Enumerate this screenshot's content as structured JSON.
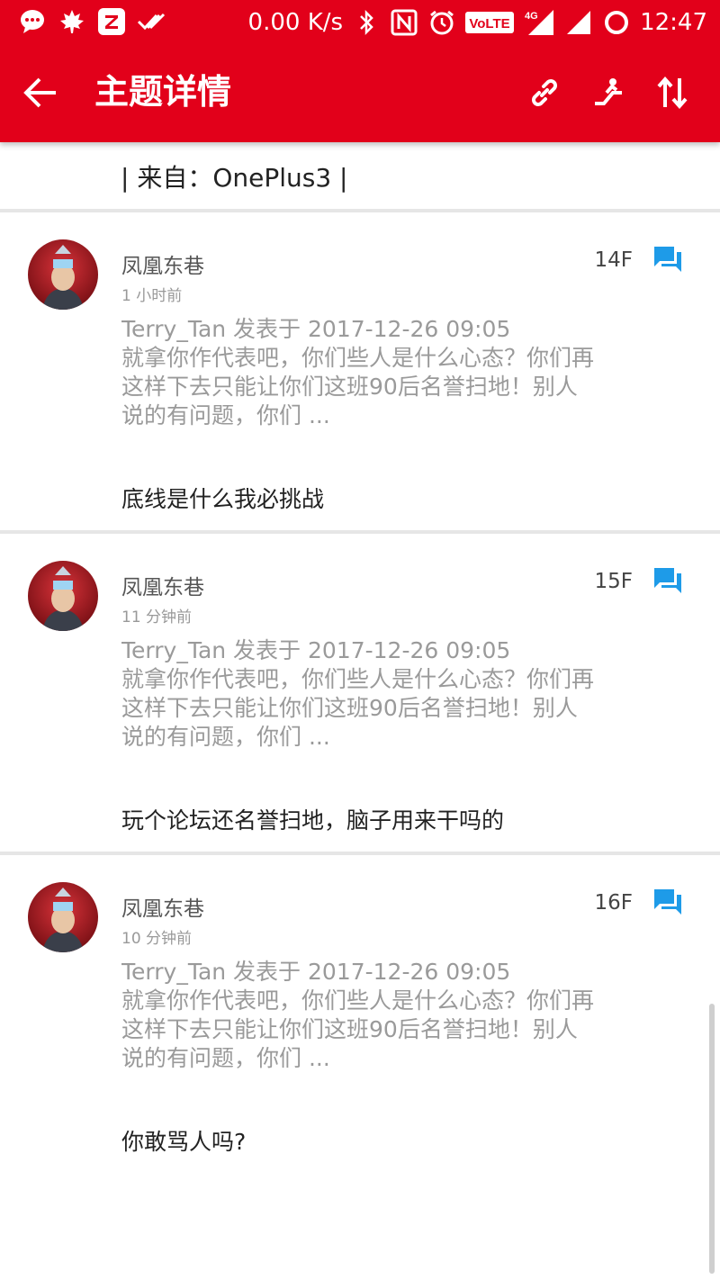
{
  "status_bar": {
    "network_speed": "0.00 K/s",
    "time": "12:47",
    "volte_label": "VoLTE",
    "network_type": "4G",
    "left_icons": [
      "chat-icon",
      "maple-leaf-icon",
      "z-app-icon",
      "double-check-icon"
    ],
    "right_icons": [
      "bluetooth-icon",
      "nfc-icon",
      "alarm-icon",
      "volte-icon",
      "signal-icon",
      "signal-icon-2",
      "battery-icon"
    ]
  },
  "appbar": {
    "title": "主题详情",
    "actions": [
      "link-icon",
      "jump-icon",
      "sort-icon"
    ]
  },
  "source_row": {
    "text": "| 来自：OnePlus3 |"
  },
  "posts": [
    {
      "author": "凤凰东巷",
      "time": "1 小时前",
      "floor": "14F",
      "quote_lines": [
        "Terry_Tan 发表于 2017-12-26 09:05",
        "就拿你作代表吧，你们些人是什么心态？你们再",
        "这样下去只能让你们这班90后名誉扫地！别人",
        "说的有问题，你们 ..."
      ],
      "reply": "底线是什么我必挑战"
    },
    {
      "author": "凤凰东巷",
      "time": "11 分钟前",
      "floor": "15F",
      "quote_lines": [
        "Terry_Tan 发表于 2017-12-26 09:05",
        "就拿你作代表吧，你们些人是什么心态？你们再",
        "这样下去只能让你们这班90后名誉扫地！别人",
        "说的有问题，你们 ..."
      ],
      "reply": "玩个论坛还名誉扫地，脑子用来干吗的"
    },
    {
      "author": "凤凰东巷",
      "time": "10 分钟前",
      "floor": "16F",
      "quote_lines": [
        "Terry_Tan 发表于 2017-12-26 09:05",
        "就拿你作代表吧，你们些人是什么心态？你们再",
        "这样下去只能让你们这班90后名誉扫地！别人",
        "说的有问题，你们 ..."
      ],
      "reply": "你敢骂人吗?"
    }
  ],
  "colors": {
    "brand_red": "#e2001a",
    "reply_icon_blue": "#1e9be8"
  }
}
